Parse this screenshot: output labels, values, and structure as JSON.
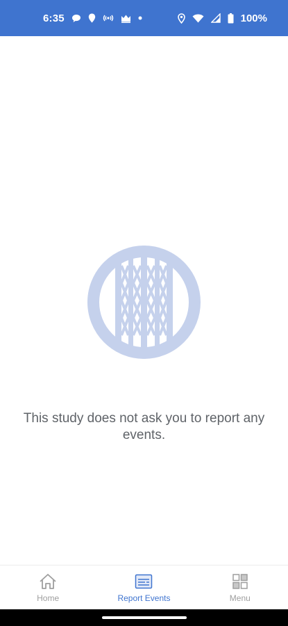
{
  "status_bar": {
    "time": "6:35",
    "battery_percent": "100%",
    "left_icons": [
      "chat-bubble-icon",
      "location-pin-icon",
      "radio-waves-icon",
      "crown-icon",
      "dot-icon"
    ],
    "right_icons": [
      "location-icon",
      "wifi-icon",
      "signal-icon",
      "battery-icon"
    ],
    "background_color": "#3f74cf"
  },
  "main": {
    "empty_state_message": "This study does not ask you to report any events.",
    "logo_color": "#c5d1ec"
  },
  "bottom_nav": {
    "items": [
      {
        "label": "Home",
        "icon": "home-icon",
        "active": false
      },
      {
        "label": "Report Events",
        "icon": "report-events-icon",
        "active": true
      },
      {
        "label": "Menu",
        "icon": "menu-grid-icon",
        "active": false
      }
    ],
    "active_color": "#3f74cf",
    "inactive_color": "#9e9e9e"
  }
}
